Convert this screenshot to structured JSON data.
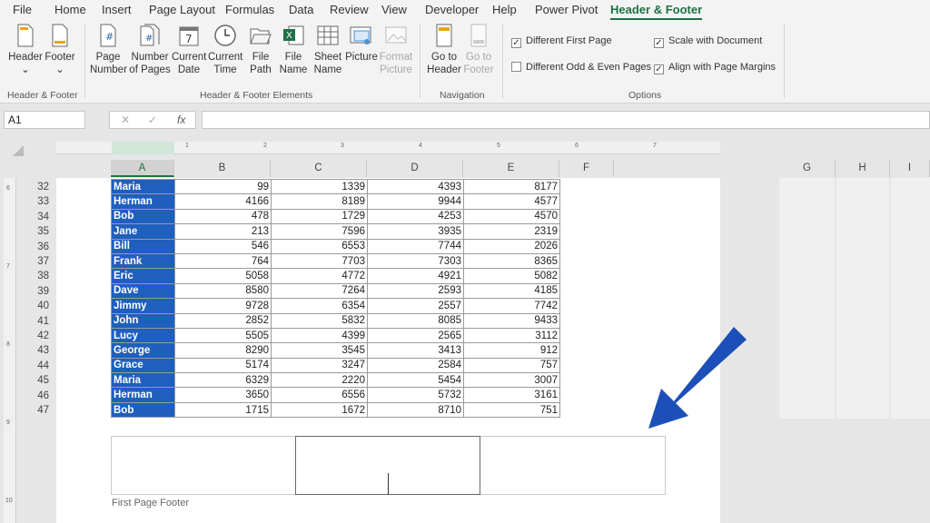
{
  "menu": [
    "File",
    "Home",
    "Insert",
    "Page Layout",
    "Formulas",
    "Data",
    "Review",
    "View",
    "Developer",
    "Help",
    "Power Pivot",
    "Header & Footer"
  ],
  "ribbon": {
    "header_footer": {
      "header": [
        "Header",
        "⌄"
      ],
      "footer": [
        "Footer",
        "⌄"
      ],
      "label": "Header & Footer"
    },
    "elements": {
      "page_number": [
        "Page",
        "Number"
      ],
      "number_of_pages": [
        "Number",
        "of Pages"
      ],
      "current_date": [
        "Current",
        "Date"
      ],
      "current_time": [
        "Current",
        "Time"
      ],
      "file_path": [
        "File",
        "Path"
      ],
      "file_name": [
        "File",
        "Name"
      ],
      "sheet_name": [
        "Sheet",
        "Name"
      ],
      "picture": [
        "Picture",
        ""
      ],
      "format_picture": [
        "Format",
        "Picture"
      ],
      "label": "Header & Footer Elements"
    },
    "navigation": {
      "go_to_header": [
        "Go to",
        "Header"
      ],
      "go_to_footer": [
        "Go to",
        "Footer"
      ],
      "label": "Navigation"
    },
    "options": {
      "different_first_page": "Different First Page",
      "different_odd_even": "Different Odd & Even Pages",
      "scale_with_document": "Scale with Document",
      "align_margins": "Align with Page Margins",
      "label": "Options",
      "checked": {
        "different_first_page": true,
        "different_odd_even": false,
        "scale_with_document": true,
        "align_margins": true
      }
    }
  },
  "formula_bar": {
    "name_box": "A1",
    "cancel": "✕",
    "enter": "✓",
    "fx": "fx",
    "formula": ""
  },
  "columns": [
    "A",
    "B",
    "C",
    "D",
    "E",
    "F",
    "G",
    "H",
    "I"
  ],
  "ruler_numbers": [
    "1",
    "2",
    "3",
    "4",
    "5",
    "6",
    "7"
  ],
  "vruler_numbers": [
    "6",
    "7",
    "8",
    "9",
    "10"
  ],
  "rows": [
    {
      "n": "32",
      "name": "Maria",
      "b": "99",
      "c": "1339",
      "d": "4393",
      "e": "8177"
    },
    {
      "n": "33",
      "name": "Herman",
      "b": "4166",
      "c": "8189",
      "d": "9944",
      "e": "4577"
    },
    {
      "n": "34",
      "name": "Bob",
      "b": "478",
      "c": "1729",
      "d": "4253",
      "e": "4570"
    },
    {
      "n": "35",
      "name": "Jane",
      "b": "213",
      "c": "7596",
      "d": "3935",
      "e": "2319"
    },
    {
      "n": "36",
      "name": "Bill",
      "b": "546",
      "c": "6553",
      "d": "7744",
      "e": "2026"
    },
    {
      "n": "37",
      "name": "Frank",
      "b": "764",
      "c": "7703",
      "d": "7303",
      "e": "8365"
    },
    {
      "n": "38",
      "name": "Eric",
      "b": "5058",
      "c": "4772",
      "d": "4921",
      "e": "5082"
    },
    {
      "n": "39",
      "name": "Dave",
      "b": "8580",
      "c": "7264",
      "d": "2593",
      "e": "4185"
    },
    {
      "n": "40",
      "name": "Jimmy",
      "b": "9728",
      "c": "6354",
      "d": "2557",
      "e": "7742"
    },
    {
      "n": "41",
      "name": "John",
      "b": "2852",
      "c": "5832",
      "d": "8085",
      "e": "9433"
    },
    {
      "n": "42",
      "name": "Lucy",
      "b": "5505",
      "c": "4399",
      "d": "2565",
      "e": "3112"
    },
    {
      "n": "43",
      "name": "George",
      "b": "8290",
      "c": "3545",
      "d": "3413",
      "e": "912"
    },
    {
      "n": "44",
      "name": "Grace",
      "b": "5174",
      "c": "3247",
      "d": "2584",
      "e": "757"
    },
    {
      "n": "45",
      "name": "Maria",
      "b": "6329",
      "c": "2220",
      "d": "5454",
      "e": "3007"
    },
    {
      "n": "46",
      "name": "Herman",
      "b": "3650",
      "c": "6556",
      "d": "5732",
      "e": "3161"
    },
    {
      "n": "47",
      "name": "Bob",
      "b": "1715",
      "c": "1672",
      "d": "8710",
      "e": "751"
    }
  ],
  "footer_label": "First Page Footer",
  "colors": {
    "accent": "#1e7145",
    "name_fill": "#1f5fbe",
    "arrow": "#1c50b8"
  }
}
